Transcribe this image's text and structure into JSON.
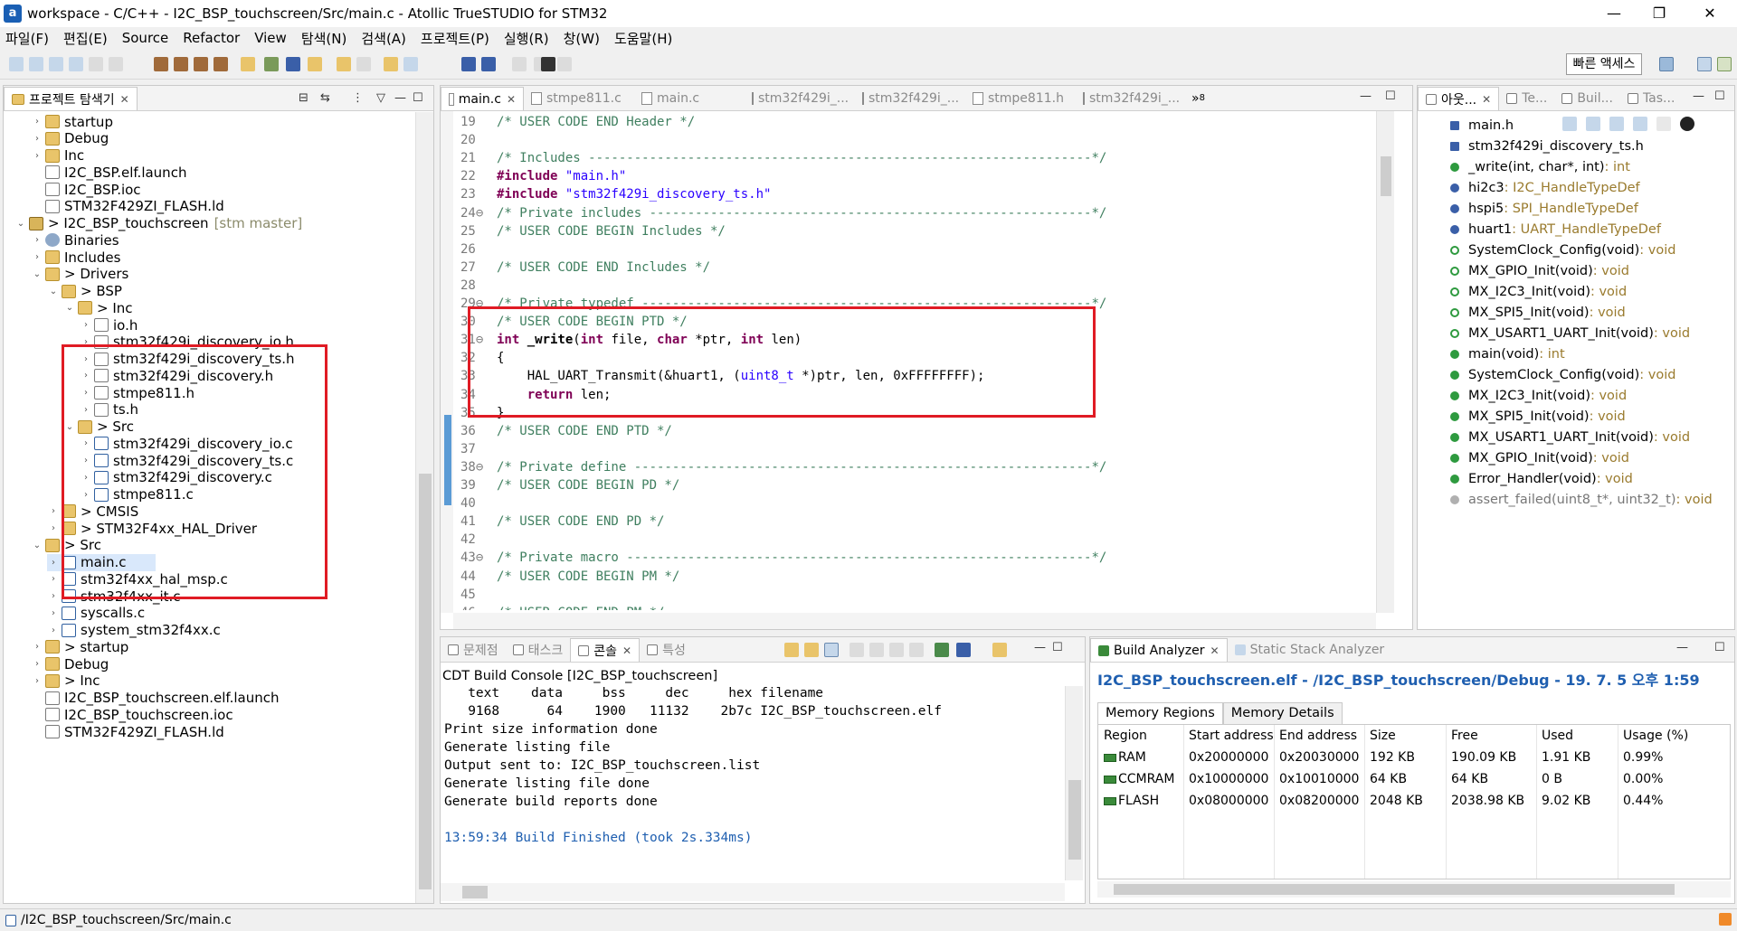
{
  "window": {
    "title": "workspace - C/C++ - I2C_BSP_touchscreen/Src/main.c - Atollic TrueSTUDIO for STM32",
    "app_icon": "a",
    "min": "—",
    "max": "❐",
    "close": "✕"
  },
  "menu": [
    "파일(F)",
    "편집(E)",
    "Source",
    "Refactor",
    "View",
    "탐색(N)",
    "검색(A)",
    "프로젝트(P)",
    "실행(R)",
    "창(W)",
    "도움말(H)"
  ],
  "quick_access": "빠른 액세스",
  "project_explorer": {
    "tab_label": "프로젝트 탐색기",
    "tree": [
      {
        "label": "startup",
        "icon": "folder",
        "indent": 1,
        "twisty": "›"
      },
      {
        "label": "Debug",
        "icon": "folder",
        "indent": 1,
        "twisty": "›"
      },
      {
        "label": "Inc",
        "icon": "folder",
        "indent": 1,
        "twisty": "›"
      },
      {
        "label": "I2C_BSP.elf.launch",
        "icon": "file",
        "indent": 1,
        "twisty": ""
      },
      {
        "label": "I2C_BSP.ioc",
        "icon": "file",
        "indent": 1,
        "twisty": ""
      },
      {
        "label": "STM32F429ZI_FLASH.ld",
        "icon": "file",
        "indent": 1,
        "twisty": ""
      },
      {
        "label": "> I2C_BSP_touchscreen",
        "icon": "proj",
        "indent": 0,
        "twisty": "⌄",
        "deco": "[stm master]"
      },
      {
        "label": "Binaries",
        "icon": "gear",
        "indent": 1,
        "twisty": "›"
      },
      {
        "label": "Includes",
        "icon": "folder",
        "indent": 1,
        "twisty": "›"
      },
      {
        "label": "> Drivers",
        "icon": "folder",
        "indent": 1,
        "twisty": "⌄"
      },
      {
        "label": "> BSP",
        "icon": "folder",
        "indent": 2,
        "twisty": "⌄"
      },
      {
        "label": "> Inc",
        "icon": "folder",
        "indent": 3,
        "twisty": "⌄"
      },
      {
        "label": "io.h",
        "icon": "file",
        "indent": 4,
        "twisty": "›"
      },
      {
        "label": "stm32f429i_discovery_io.h",
        "icon": "file",
        "indent": 4,
        "twisty": "›"
      },
      {
        "label": "stm32f429i_discovery_ts.h",
        "icon": "file",
        "indent": 4,
        "twisty": "›"
      },
      {
        "label": "stm32f429i_discovery.h",
        "icon": "file",
        "indent": 4,
        "twisty": "›"
      },
      {
        "label": "stmpe811.h",
        "icon": "file",
        "indent": 4,
        "twisty": "›"
      },
      {
        "label": "ts.h",
        "icon": "file",
        "indent": 4,
        "twisty": "›"
      },
      {
        "label": "> Src",
        "icon": "folder",
        "indent": 3,
        "twisty": "⌄"
      },
      {
        "label": "stm32f429i_discovery_io.c",
        "icon": "cfile",
        "indent": 4,
        "twisty": "›"
      },
      {
        "label": "stm32f429i_discovery_ts.c",
        "icon": "cfile",
        "indent": 4,
        "twisty": "›"
      },
      {
        "label": "stm32f429i_discovery.c",
        "icon": "cfile",
        "indent": 4,
        "twisty": "›"
      },
      {
        "label": "stmpe811.c",
        "icon": "cfile",
        "indent": 4,
        "twisty": "›"
      },
      {
        "label": "> CMSIS",
        "icon": "folder",
        "indent": 2,
        "twisty": "›"
      },
      {
        "label": "> STM32F4xx_HAL_Driver",
        "icon": "folder",
        "indent": 2,
        "twisty": "›"
      },
      {
        "label": "> Src",
        "icon": "folder",
        "indent": 1,
        "twisty": "⌄"
      },
      {
        "label": "main.c",
        "icon": "cfile",
        "indent": 2,
        "twisty": "›",
        "selected": true
      },
      {
        "label": "stm32f4xx_hal_msp.c",
        "icon": "cfile",
        "indent": 2,
        "twisty": "›"
      },
      {
        "label": "stm32f4xx_it.c",
        "icon": "cfile",
        "indent": 2,
        "twisty": "›"
      },
      {
        "label": "syscalls.c",
        "icon": "cfile",
        "indent": 2,
        "twisty": "›"
      },
      {
        "label": "system_stm32f4xx.c",
        "icon": "cfile",
        "indent": 2,
        "twisty": "›"
      },
      {
        "label": "> startup",
        "icon": "folder",
        "indent": 1,
        "twisty": "›"
      },
      {
        "label": "Debug",
        "icon": "folder",
        "indent": 1,
        "twisty": "›"
      },
      {
        "label": "> Inc",
        "icon": "folder",
        "indent": 1,
        "twisty": "›"
      },
      {
        "label": "I2C_BSP_touchscreen.elf.launch",
        "icon": "file",
        "indent": 1,
        "twisty": ""
      },
      {
        "label": "I2C_BSP_touchscreen.ioc",
        "icon": "file",
        "indent": 1,
        "twisty": ""
      },
      {
        "label": "STM32F429ZI_FLASH.ld",
        "icon": "file",
        "indent": 1,
        "twisty": ""
      }
    ]
  },
  "editor": {
    "tabs": [
      "main.c",
      "stmpe811.c",
      "main.c",
      "stm32f429i_...",
      "stm32f429i_...",
      "stmpe811.h",
      "stm32f429i_..."
    ],
    "overflow": "»",
    "overflow_count": "8",
    "lines": [
      {
        "n": "19",
        "parts": [
          [
            "cm",
            "/* USER CODE END Header */"
          ]
        ]
      },
      {
        "n": "20",
        "parts": []
      },
      {
        "n": "21",
        "parts": [
          [
            "cm",
            "/* Includes ------------------------------------------------------------------*/"
          ]
        ]
      },
      {
        "n": "22",
        "parts": [
          [
            "kw",
            "#include "
          ],
          [
            "st",
            "\"main.h\""
          ]
        ]
      },
      {
        "n": "23",
        "parts": [
          [
            "kw",
            "#include "
          ],
          [
            "st",
            "\"stm32f429i_discovery_ts.h\""
          ]
        ]
      },
      {
        "n": "24⊖",
        "parts": [
          [
            "cm",
            "/* Private includes ----------------------------------------------------------*/"
          ]
        ]
      },
      {
        "n": "25",
        "parts": [
          [
            "cm",
            "/* USER CODE BEGIN Includes */"
          ]
        ]
      },
      {
        "n": "26",
        "parts": []
      },
      {
        "n": "27",
        "parts": [
          [
            "cm",
            "/* USER CODE END Includes */"
          ]
        ]
      },
      {
        "n": "28",
        "parts": []
      },
      {
        "n": "29⊖",
        "parts": [
          [
            "cm",
            "/* Private typedef -----------------------------------------------------------*/"
          ]
        ]
      },
      {
        "n": "30",
        "parts": [
          [
            "cm",
            "/* USER CODE BEGIN PTD */"
          ]
        ]
      },
      {
        "n": "31⊖",
        "parts": [
          [
            "kw",
            "int "
          ],
          [
            "fn",
            "_write"
          ],
          [
            "",
            "("
          ],
          [
            "kw",
            "int"
          ],
          [
            "",
            " file, "
          ],
          [
            "kw",
            "char"
          ],
          [
            "",
            " *ptr, "
          ],
          [
            "kw",
            "int"
          ],
          [
            "",
            " len)"
          ]
        ]
      },
      {
        "n": "32",
        "parts": [
          [
            "",
            "{"
          ]
        ]
      },
      {
        "n": "33",
        "parts": [
          [
            "",
            "    HAL_UART_Transmit(&huart1, ("
          ],
          [
            "st",
            "uint8_t"
          ],
          [
            "",
            " *)ptr, len, 0xFFFFFFFF);"
          ]
        ]
      },
      {
        "n": "34",
        "parts": [
          [
            "kw",
            "    return"
          ],
          [
            "",
            " len;"
          ]
        ]
      },
      {
        "n": "35",
        "parts": [
          [
            "",
            "}"
          ]
        ]
      },
      {
        "n": "36",
        "parts": [
          [
            "cm",
            "/* USER CODE END PTD */"
          ]
        ]
      },
      {
        "n": "37",
        "parts": []
      },
      {
        "n": "38⊖",
        "parts": [
          [
            "cm",
            "/* Private define ------------------------------------------------------------*/"
          ]
        ]
      },
      {
        "n": "39",
        "parts": [
          [
            "cm",
            "/* USER CODE BEGIN PD */"
          ]
        ]
      },
      {
        "n": "40",
        "parts": []
      },
      {
        "n": "41",
        "parts": [
          [
            "cm",
            "/* USER CODE END PD */"
          ]
        ]
      },
      {
        "n": "42",
        "parts": []
      },
      {
        "n": "43⊖",
        "parts": [
          [
            "cm",
            "/* Private macro -------------------------------------------------------------*/"
          ]
        ]
      },
      {
        "n": "44",
        "parts": [
          [
            "cm",
            "/* USER CODE BEGIN PM */"
          ]
        ]
      },
      {
        "n": "45",
        "parts": []
      },
      {
        "n": "46",
        "parts": [
          [
            "cm",
            "/* USER CODE END PM */"
          ]
        ]
      }
    ]
  },
  "outline": {
    "tabs": [
      "아웃...",
      "Te...",
      "Buil...",
      "Tas..."
    ],
    "items": [
      {
        "name": "main.h",
        "type": "",
        "kind": "hdr"
      },
      {
        "name": "stm32f429i_discovery_ts.h",
        "type": "",
        "kind": "hdr"
      },
      {
        "name": "_write(int, char*, int)",
        "type": " : int",
        "kind": "func"
      },
      {
        "name": "hi2c3",
        "type": " : I2C_HandleTypeDef",
        "kind": "var"
      },
      {
        "name": "hspi5",
        "type": " : SPI_HandleTypeDef",
        "kind": "var"
      },
      {
        "name": "huart1",
        "type": " : UART_HandleTypeDef",
        "kind": "var"
      },
      {
        "name": "SystemClock_Config(void)",
        "type": " : void",
        "kind": "decl"
      },
      {
        "name": "MX_GPIO_Init(void)",
        "type": " : void",
        "kind": "decl-s"
      },
      {
        "name": "MX_I2C3_Init(void)",
        "type": " : void",
        "kind": "decl-s"
      },
      {
        "name": "MX_SPI5_Init(void)",
        "type": " : void",
        "kind": "decl-s"
      },
      {
        "name": "MX_USART1_UART_Init(void)",
        "type": " : void",
        "kind": "decl-s"
      },
      {
        "name": "main(void)",
        "type": " : int",
        "kind": "func"
      },
      {
        "name": "SystemClock_Config(void)",
        "type": " : void",
        "kind": "func"
      },
      {
        "name": "MX_I2C3_Init(void)",
        "type": " : void",
        "kind": "func-s"
      },
      {
        "name": "MX_SPI5_Init(void)",
        "type": " : void",
        "kind": "func-s"
      },
      {
        "name": "MX_USART1_UART_Init(void)",
        "type": " : void",
        "kind": "func-s"
      },
      {
        "name": "MX_GPIO_Init(void)",
        "type": " : void",
        "kind": "func-s"
      },
      {
        "name": "Error_Handler(void)",
        "type": " : void",
        "kind": "func"
      },
      {
        "name": "assert_failed(uint8_t*, uint32_t)",
        "type": " : void",
        "kind": "macro"
      }
    ]
  },
  "console": {
    "tabs": [
      "문제점",
      "태스크",
      "콘솔",
      "특성"
    ],
    "title": "CDT Build Console [I2C_BSP_touchscreen]",
    "lines": [
      "   text    data     bss     dec     hex filename",
      "   9168      64    1900   11132    2b7c I2C_BSP_touchscreen.elf",
      "Print size information done",
      "Generate listing file",
      "Output sent to: I2C_BSP_touchscreen.list",
      "Generate listing file done",
      "Generate build reports done",
      "",
      "13:59:34 Build Finished (took 2s.334ms)"
    ]
  },
  "build_analyzer": {
    "tabs": [
      "Build Analyzer",
      "Static Stack Analyzer"
    ],
    "heading": "I2C_BSP_touchscreen.elf - /I2C_BSP_touchscreen/Debug - 19. 7. 5 오후 1:59",
    "subtabs": [
      "Memory Regions",
      "Memory Details"
    ],
    "columns": [
      "Region",
      "Start address",
      "End address",
      "Size",
      "Free",
      "Used",
      "Usage (%)"
    ],
    "rows": [
      [
        "RAM",
        "0x20000000",
        "0x20030000",
        "192 KB",
        "190.09 KB",
        "1.91 KB",
        "0.99%"
      ],
      [
        "CCMRAM",
        "0x10000000",
        "0x10010000",
        "64 KB",
        "64 KB",
        "0 B",
        "0.00%"
      ],
      [
        "FLASH",
        "0x08000000",
        "0x08200000",
        "2048 KB",
        "2038.98 KB",
        "9.02 KB",
        "0.44%"
      ]
    ]
  },
  "status": {
    "path": "/I2C_BSP_touchscreen/Src/main.c"
  },
  "colors": {
    "highlight_box": "#e01b24",
    "comment": "#3f7f5f",
    "keyword": "#7f0055",
    "string": "#2a00ff",
    "link_heading": "#1f5fb0"
  }
}
